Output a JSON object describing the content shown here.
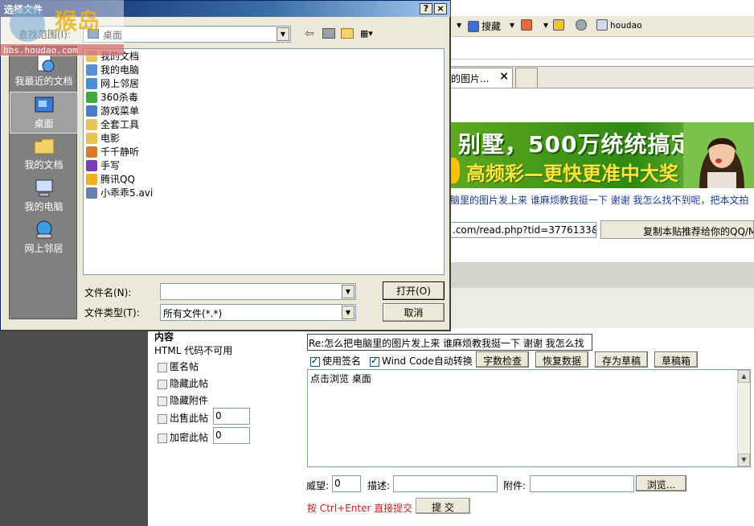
{
  "browser": {
    "toolbar": {
      "search_label": "搜藏",
      "user_label": "houdao"
    },
    "tab": {
      "title": "的图片...",
      "close": "×"
    },
    "banner": {
      "line1": "别墅，500万统统搞定!",
      "line2": "高频彩—更快更准中大奖"
    },
    "links": "脑里的图片发上来  谁麻烦教我挺一下  谢谢    我怎么找不到呢，把本文拍",
    "url": ".com/read.php?tid=3776133&u=1",
    "recommend_button": "复制本贴推荐给你的QQ/M"
  },
  "form": {
    "content_label": "内容",
    "html_note": "HTML 代码不可用",
    "options": [
      {
        "label": "匿名帖"
      },
      {
        "label": "隐藏此帖"
      },
      {
        "label": "隐藏附件"
      },
      {
        "label": "出售此帖",
        "value": "0"
      },
      {
        "label": "加密此帖",
        "value": "0"
      }
    ],
    "title_value": "Re:怎么把电脑里的图片发上来  谁麻烦教我挺一下  谢谢    我怎么找",
    "use_signature": "使用签名",
    "windcode": "Wind Code自动转换",
    "buttons": {
      "check": "字数检查",
      "restore": "恢复数据",
      "save_draft": "存为草稿",
      "draft_box": "草稿箱"
    },
    "body_text": "点击浏览   桌面",
    "weiwang_label": "威望:",
    "weiwang_value": "0",
    "desc_label": "描述:",
    "attach_label": "附件:",
    "browse_button": "浏览...",
    "shortcut_hint": "按  Ctrl+Enter 直接提交",
    "submit_button": "提  交"
  },
  "dialog": {
    "title": "选择文件",
    "help": "?",
    "close": "×",
    "lookin_label": "查找范围(I):",
    "lookin_value": "桌面",
    "places": [
      {
        "label": "我最近的文档"
      },
      {
        "label": "桌面"
      },
      {
        "label": "我的文档"
      },
      {
        "label": "我的电脑"
      },
      {
        "label": "网上邻居"
      }
    ],
    "files": [
      {
        "name": "我的文档",
        "color": "#e8c25a"
      },
      {
        "name": "我的电脑",
        "color": "#5a8fd6"
      },
      {
        "name": "网上邻居",
        "color": "#4a8fd0"
      },
      {
        "name": "360杀毒",
        "color": "#3faa3f"
      },
      {
        "name": "游戏菜单",
        "color": "#4f7cc9"
      },
      {
        "name": "全套工具",
        "color": "#e8c25a"
      },
      {
        "name": "电影",
        "color": "#e8c25a"
      },
      {
        "name": "千千静听",
        "color": "#d87a2a"
      },
      {
        "name": "手写",
        "color": "#7a3fb5"
      },
      {
        "name": "腾讯QQ",
        "color": "#f2b01e"
      },
      {
        "name": "小乖乖5.avi",
        "color": "#6a7fb0"
      }
    ],
    "filename_label": "文件名(N):",
    "filetype_label": "文件类型(T):",
    "filetype_value": "所有文件(*.*)",
    "open_button": "打开(O)",
    "cancel_button": "取消"
  },
  "watermark": {
    "text": "bbs.houdao.com",
    "brand": "猴岛"
  }
}
